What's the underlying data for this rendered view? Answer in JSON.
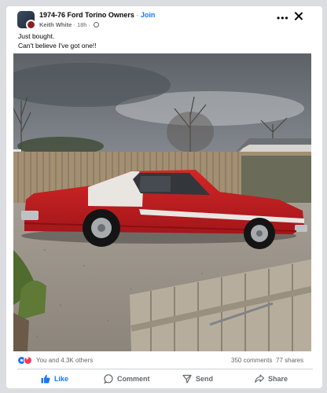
{
  "post": {
    "group_name": "1974-76 Ford Torino Owners",
    "join_label": "Join",
    "author": "Keith White",
    "time": "18h",
    "text_line1": "Just bought.",
    "text_line2": "Can't believe I've got one!!"
  },
  "header_icons": {
    "more": "more-dots-icon",
    "close": "close-icon",
    "privacy": "globe-icon"
  },
  "photo": {
    "subject": "car-photo"
  },
  "reactions": {
    "text": "You and 4.3K others",
    "comments": "350 comments",
    "shares": "77 shares",
    "icons": [
      "like-reaction-icon",
      "love-reaction-icon"
    ]
  },
  "actions": {
    "like": "Like",
    "comment": "Comment",
    "send": "Send",
    "share": "Share"
  },
  "colors": {
    "accent": "#1877f2",
    "love": "#f33e58",
    "muted": "#65676b",
    "car_red": "#c41e1e"
  }
}
